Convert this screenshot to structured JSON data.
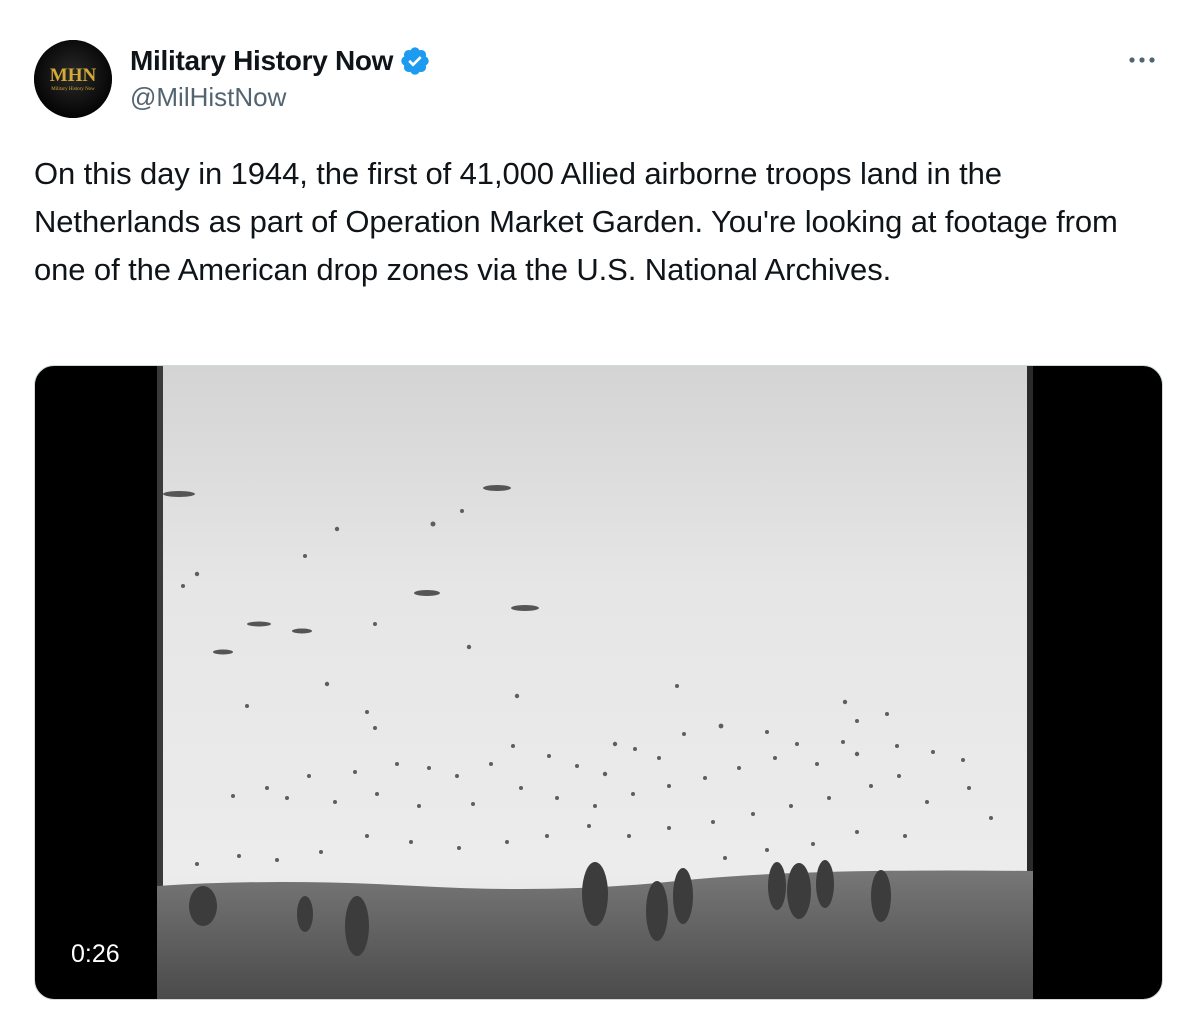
{
  "tweet": {
    "avatar": {
      "logo_text": "MHN",
      "logo_subtext": "Military History Now"
    },
    "author": {
      "display_name": "Military History Now",
      "handle": "@MilHistNow",
      "verified": true
    },
    "more_icon": "more-horizontal-icon",
    "text": "On this day in 1944, the first of 41,000 Allied airborne troops land in the Netherlands as part of Operation Market Garden. You're looking at footage from one of the American drop zones via the U.S. National Archives.",
    "media": {
      "type": "video",
      "duration": "0:26"
    }
  },
  "colors": {
    "text": "#0f1419",
    "secondary_text": "#536471",
    "verified_badge": "#1d9bf0",
    "logo_gold": "#d4a937",
    "media_border": "#cfd9de"
  }
}
